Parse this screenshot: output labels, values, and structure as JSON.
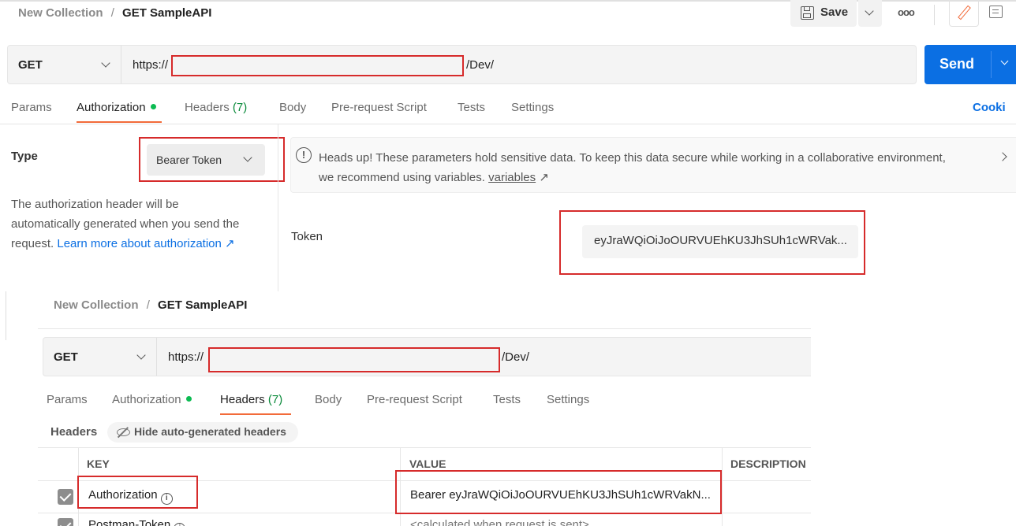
{
  "top": {
    "breadcrumb": {
      "collection": "New Collection",
      "separator": "/",
      "request": "GET SampleAPI"
    },
    "toolbar": {
      "save_label": "Save",
      "more_label": "ooo"
    },
    "method": "GET",
    "url_prefix": "https://",
    "url_suffix": "/Dev/",
    "send_label": "Send",
    "tabs": {
      "params": "Params",
      "authorization": "Authorization",
      "headers": "Headers",
      "headers_count": "(7)",
      "body": "Body",
      "prerequest": "Pre-request Script",
      "tests": "Tests",
      "settings": "Settings",
      "cookies": "Cooki"
    },
    "auth": {
      "type_label": "Type",
      "type_value": "Bearer Token",
      "desc_line1": "The authorization header will be",
      "desc_line2": "automatically generated when you send the",
      "desc_line3": "request. ",
      "learn_more": "Learn more about authorization ↗",
      "banner_line1": "Heads up! These parameters hold sensitive data. To keep this data secure while working in a collaborative environment,",
      "banner_line2": "we recommend using variables. ",
      "banner_link": "variables",
      "banner_arrow": "↗",
      "token_label": "Token",
      "token_value": "eyJraWQiOiJoOURVUEhKU3JhSUh1cWRVak..."
    }
  },
  "bottom": {
    "breadcrumb": {
      "collection": "New Collection",
      "separator": "/",
      "request": "GET SampleAPI"
    },
    "method": "GET",
    "url_prefix": "https://",
    "url_suffix": "/Dev/",
    "tabs": {
      "params": "Params",
      "authorization": "Authorization",
      "headers": "Headers",
      "headers_count": "(7)",
      "body": "Body",
      "prerequest": "Pre-request Script",
      "tests": "Tests",
      "settings": "Settings"
    },
    "headers_title": "Headers",
    "hide_auto": "Hide auto-generated headers",
    "columns": {
      "key": "KEY",
      "value": "VALUE",
      "description": "DESCRIPTION"
    },
    "rows": [
      {
        "key": "Authorization",
        "value": "Bearer eyJraWQiOiJoOURVUEhKU3JhSUh1cWRVakN..."
      },
      {
        "key": "Postman-Token",
        "value": "<calculated when request is sent>"
      }
    ]
  },
  "colors": {
    "accent": "#f26b3a",
    "send": "#0b6fe3",
    "link": "#0b6fe3",
    "annotation": "#d62b2b",
    "status_dot": "#0cbb52"
  }
}
